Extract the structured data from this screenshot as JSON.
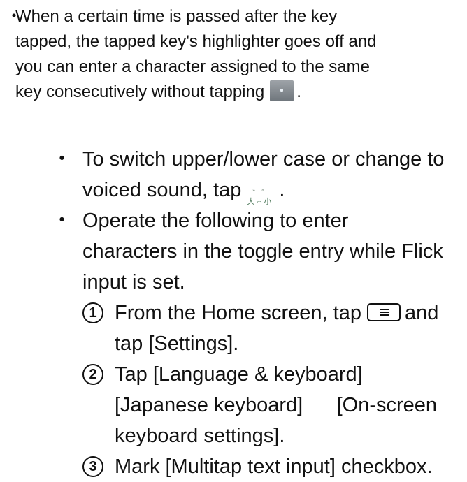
{
  "note": {
    "bullet": "・",
    "lines": [
      "When a certain time is passed after the key",
      "tapped, the tapped key's highlighter goes off and",
      "you can enter a character assigned to the same",
      "key consecutively without tapping"
    ],
    "line4_end": ".",
    "icon": "forward-key-icon"
  },
  "list": {
    "bullet": "・",
    "item1": {
      "line1": "To switch upper/lower case or change to",
      "line2_before": "voiced sound, tap",
      "line2_after": ".",
      "icon": "case-voiced-key-icon",
      "icon_text_top": "゛゜",
      "icon_text_bottom": "大⇔小"
    },
    "item2": {
      "lines": [
        "Operate the following to enter",
        "characters in the toggle entry while Flick",
        "input is set."
      ]
    },
    "steps": [
      {
        "num": "1",
        "line1_before": "From the Home screen, tap",
        "line1_after": "and",
        "line2": "tap [Settings].",
        "icon": "menu-key-icon"
      },
      {
        "num": "2",
        "line1": "Tap [Language & keyboard]",
        "line2": "[Japanese keyboard]      [On-screen",
        "line3": "keyboard settings]."
      },
      {
        "num": "3",
        "line1": "Mark [Multitap text input] checkbox."
      }
    ]
  }
}
